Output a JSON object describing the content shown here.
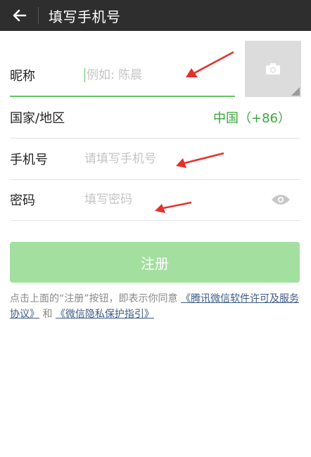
{
  "header": {
    "title": "填写手机号"
  },
  "form": {
    "nickname": {
      "label": "昵称",
      "placeholder": "例如: 陈晨"
    },
    "region": {
      "label": "国家/地区",
      "value": "中国（+86）"
    },
    "phone": {
      "label": "手机号",
      "placeholder": "请填写手机号"
    },
    "password": {
      "label": "密码",
      "placeholder": "填写密码"
    }
  },
  "register_button": {
    "label": "注册"
  },
  "agreement": {
    "prefix": "点击上面的“注册”按钮，即表示你同意 ",
    "link1": "《腾讯微信软件许可及服务协议》",
    "middle": " 和 ",
    "link2": "《微信隐私保护指引》"
  },
  "colors": {
    "titlebar": "#2e2e2e",
    "accent_green": "#3aa63a",
    "button_disabled": "#a3df9f",
    "link": "#3d5b85",
    "annotation_arrow": "#e5302a"
  },
  "icons": [
    "back-arrow-icon",
    "camera-icon",
    "eye-icon"
  ]
}
